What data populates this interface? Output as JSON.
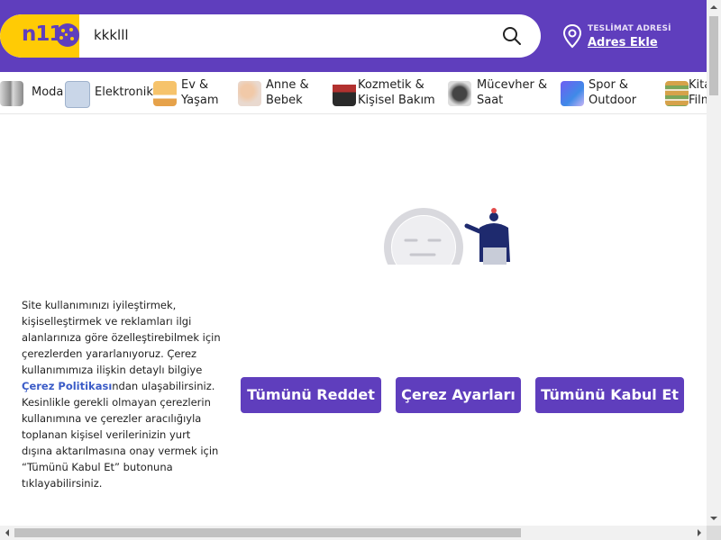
{
  "header": {
    "logo_text": "n11",
    "search_value": "kkklll",
    "delivery_title": "TESLİMAT ADRESİ",
    "delivery_link": "Adres Ekle"
  },
  "categories": [
    {
      "label": "Moda"
    },
    {
      "label": "Elektronik"
    },
    {
      "label": "Ev &\nYaşam",
      "line1": "Ev &",
      "line2": "Yaşam"
    },
    {
      "label": "Anne & Bebek",
      "line1": "Anne &",
      "line2": "Bebek"
    },
    {
      "label": "Kozmetik & Kişisel Bakım",
      "line1": "Kozmetik &",
      "line2": "Kişisel Bakım"
    },
    {
      "label": "Mücevher & Saat",
      "line1": "Mücevher &",
      "line2": "Saat"
    },
    {
      "label": "Spor & Outdoor",
      "line1": "Spor &",
      "line2": "Outdoor"
    },
    {
      "label": "Kitap Film",
      "line1": "Kita",
      "line2": "Film"
    }
  ],
  "cookie": {
    "text_before": "Site kullanımınızı iyileştirmek, kişiselleştirmek ve reklamları ilgi alanlarınıza göre özelleştirebilmek için çerezlerden yararlanıyoruz. Çerez kullanımımıza ilişkin detaylı bilgiye ",
    "link": "Çerez Politikası",
    "text_after": "ndan ulaşabilirsiniz. Kesinlikle gerekli olmayan çerezlerin kullanımına ve çerezler aracılığıyla toplanan kişisel verilerinizin yurt dışına aktarılmasına onay vermek için “Tümünü Kabul Et” butonuna tıklayabilirsiniz.",
    "reject_all": "Tümünü Reddet",
    "settings": "Çerez Ayarları",
    "accept_all": "Tümünü Kabul Et"
  },
  "colors": {
    "brand_purple": "#5f3ebd",
    "brand_yellow": "#ffcb05",
    "link_blue": "#3a5bc7"
  },
  "icons": [
    "search-icon",
    "location-pin-icon"
  ]
}
